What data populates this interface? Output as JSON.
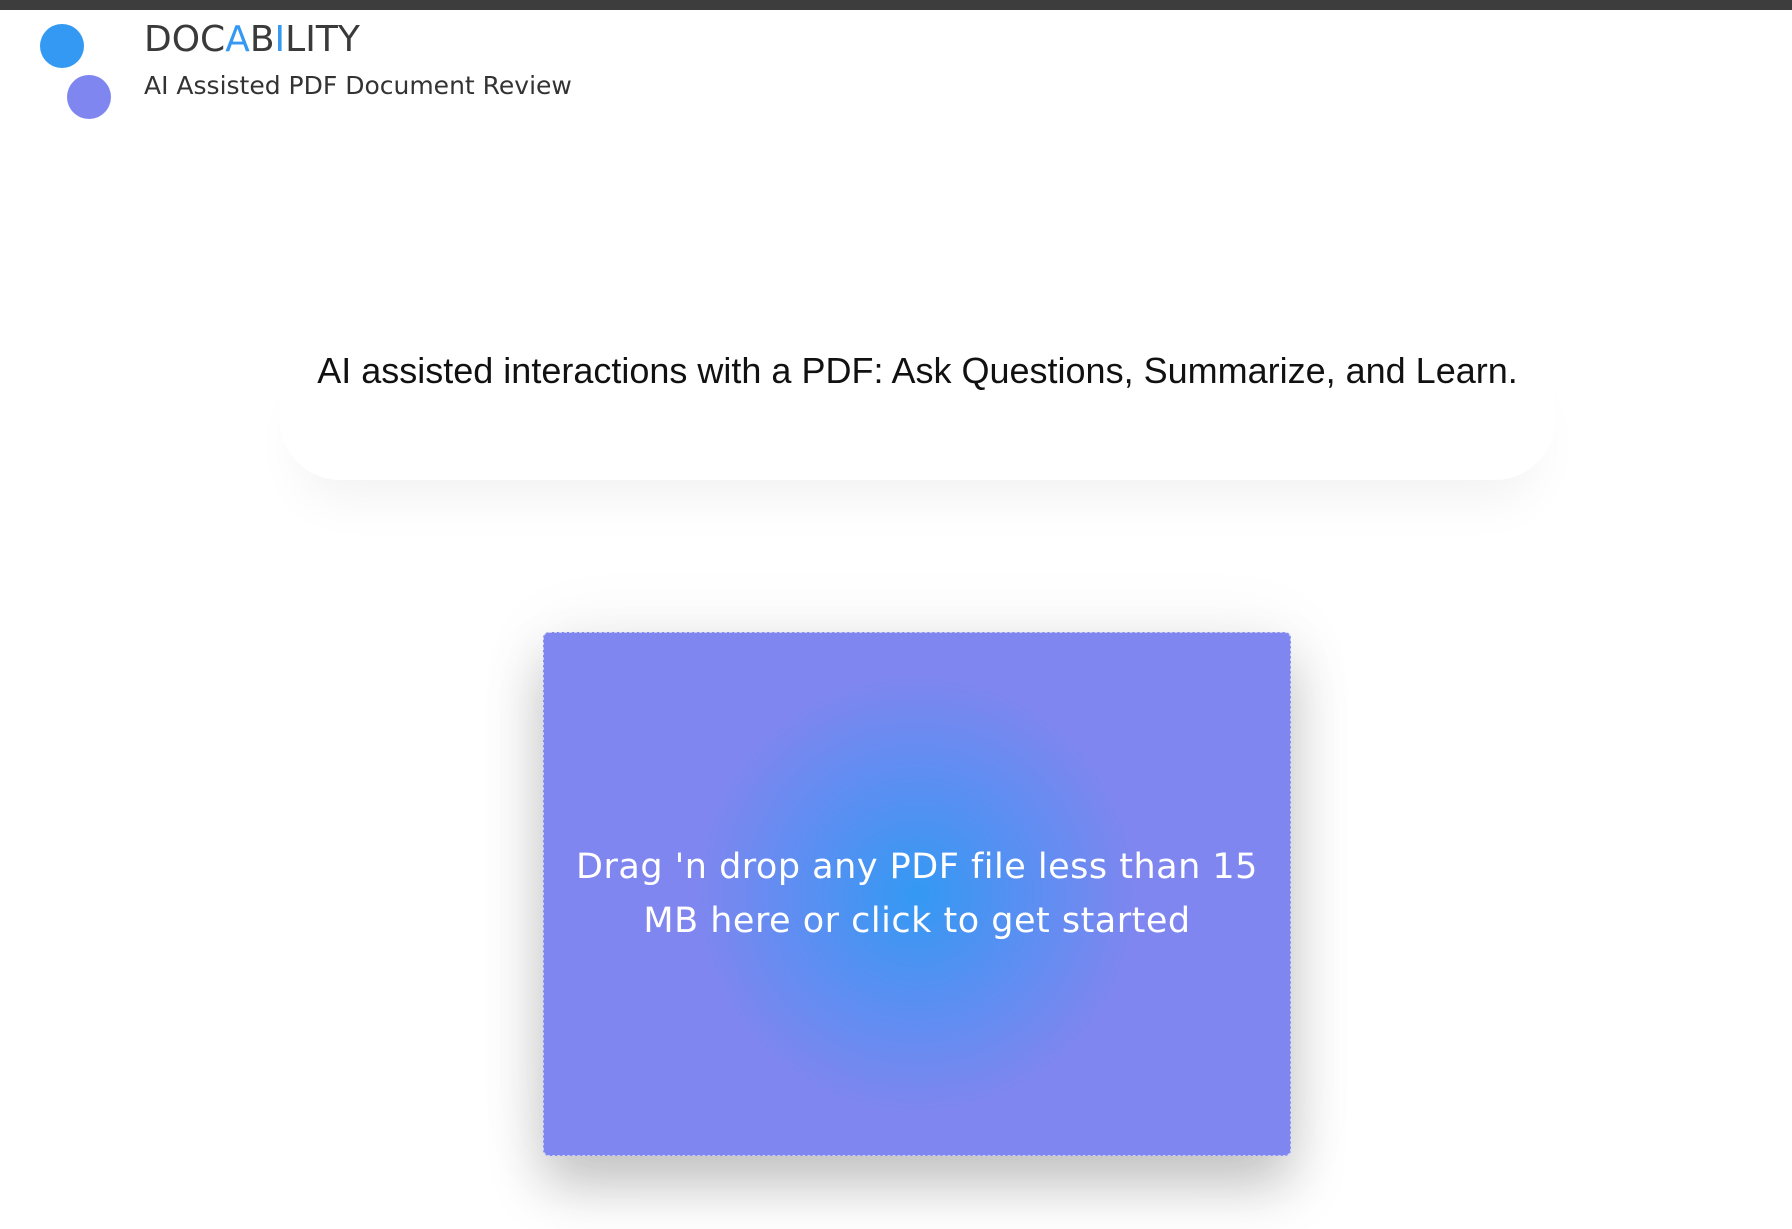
{
  "header": {
    "brand_part1": "DOC",
    "brand_accent1": "A",
    "brand_part2": "B",
    "brand_accent2": "I",
    "brand_part3": "LITY",
    "tagline": "AI Assisted PDF Document Review",
    "logo_dot_colors": [
      "#3399f3",
      "#7f86ef"
    ]
  },
  "main": {
    "headline": "AI assisted interactions with a PDF: Ask Questions, Summarize, and Learn.",
    "dropzone": {
      "text": "Drag 'n drop any PDF file less than 15 MB here or click to get started",
      "colors": {
        "center": "#3399f3",
        "edge": "#7f86ef"
      }
    }
  },
  "theme": {
    "topbar_color": "#3d3d3d",
    "accent": "#3399f3"
  }
}
